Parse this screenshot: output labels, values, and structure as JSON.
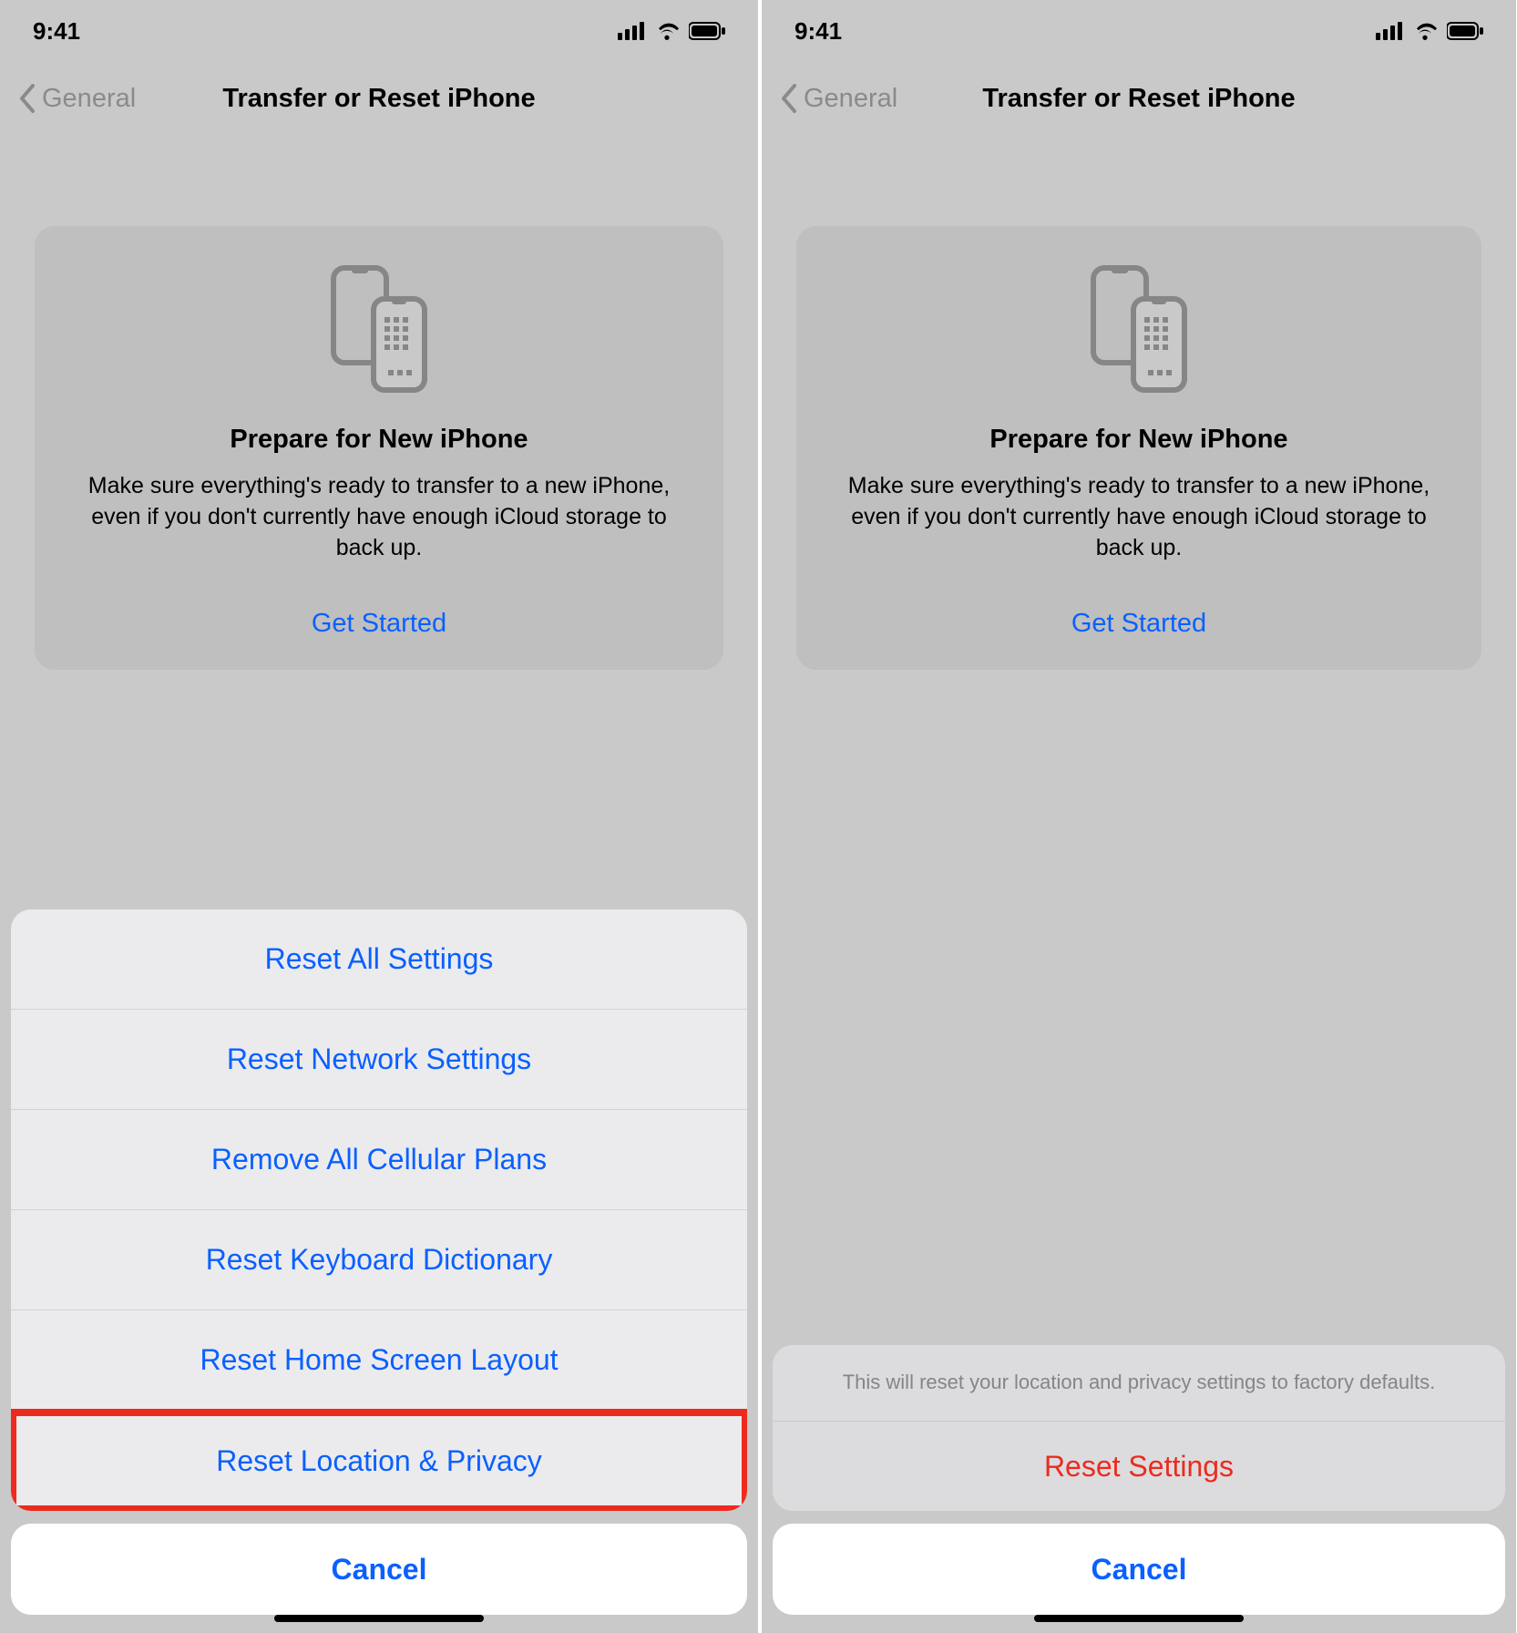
{
  "status": {
    "time": "9:41"
  },
  "nav": {
    "back_label": "General",
    "title": "Transfer or Reset iPhone"
  },
  "prepare": {
    "title": "Prepare for New iPhone",
    "subtitle": "Make sure everything's ready to transfer to a new iPhone, even if you don't currently have enough iCloud storage to back up.",
    "get_started": "Get Started"
  },
  "reset_sheet": {
    "items": [
      "Reset All Settings",
      "Reset Network Settings",
      "Remove All Cellular Plans",
      "Reset Keyboard Dictionary",
      "Reset Home Screen Layout",
      "Reset Location & Privacy"
    ],
    "cancel": "Cancel"
  },
  "confirm_sheet": {
    "message": "This will reset your location and privacy settings to factory defaults.",
    "action": "Reset Settings",
    "cancel": "Cancel"
  },
  "colors": {
    "accent": "#0a60ff",
    "destructive": "#ec2b1e",
    "highlight_border": "#ec2b1e"
  }
}
